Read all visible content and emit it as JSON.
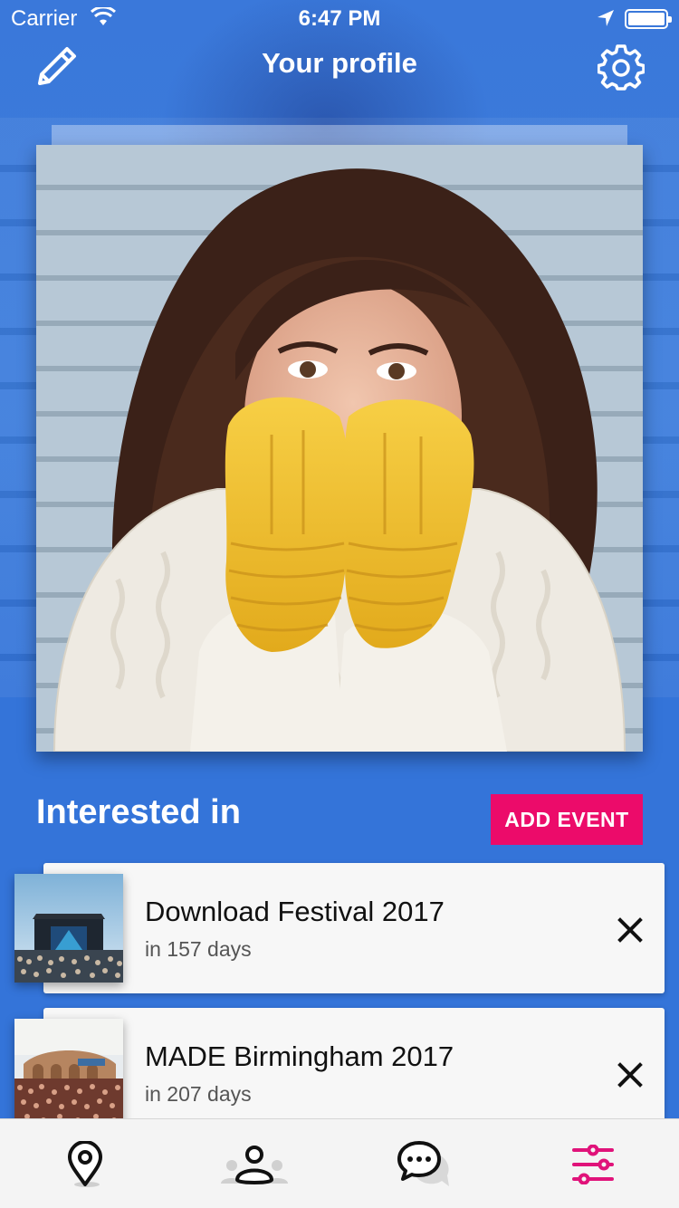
{
  "status_bar": {
    "carrier": "Carrier",
    "time": "6:47 PM"
  },
  "header": {
    "title": "Your profile",
    "edit_icon": "pencil-icon",
    "settings_icon": "gear-icon"
  },
  "interested": {
    "title": "Interested in",
    "add_button": "ADD EVENT",
    "events": [
      {
        "name": "Download Festival 2017",
        "days": "in 157 days"
      },
      {
        "name": "MADE Birmingham 2017",
        "days": "in 207 days"
      }
    ]
  },
  "tabs": [
    {
      "icon": "map-pin-icon",
      "active": false
    },
    {
      "icon": "people-icon",
      "active": false
    },
    {
      "icon": "chat-icon",
      "active": false
    },
    {
      "icon": "sliders-icon",
      "active": true
    }
  ],
  "colors": {
    "background": "#3474d9",
    "accent": "#ec0b6a",
    "card": "#f7f7f7"
  }
}
